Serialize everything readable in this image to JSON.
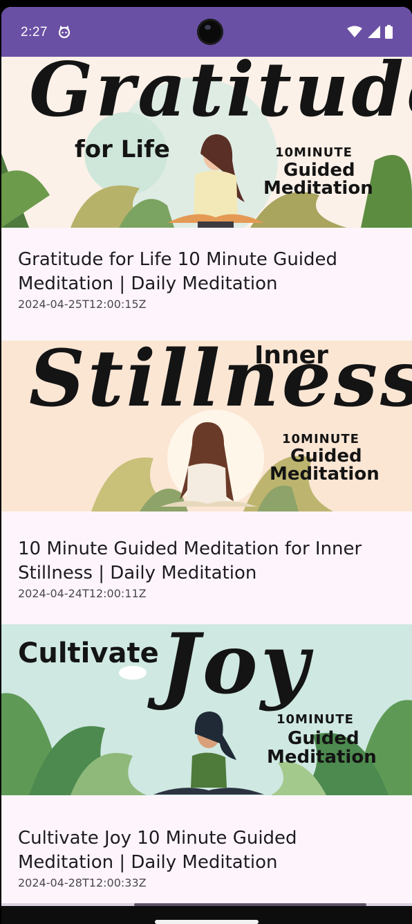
{
  "status_bar": {
    "time": "2:27",
    "app_icon": "cat-face-icon",
    "icons": [
      "wifi-icon",
      "signal-icon",
      "battery-icon"
    ],
    "bg_color": "#6a50a4"
  },
  "videos": [
    {
      "title": "Gratitude for Life 10 Minute Guided Meditation | Daily Meditation",
      "date": "2024-04-25T12:00:15Z",
      "thumb": {
        "script": "Gratitude",
        "headline": "for Life",
        "tag": "10MINUTE",
        "line1": "Guided",
        "line2": "Meditation",
        "bg": "#fbf1e8"
      }
    },
    {
      "title": "10 Minute Guided Meditation for Inner Stillness | Daily Meditation",
      "date": "2024-04-24T12:00:11Z",
      "thumb": {
        "script": "Stillness",
        "headline": "Inner",
        "tag": "10MINUTE",
        "line1": "Guided",
        "line2": "Meditation",
        "bg": "#fbe6d4"
      }
    },
    {
      "title": "Cultivate Joy 10 Minute Guided Meditation | Daily Meditation",
      "date": "2024-04-28T12:00:33Z",
      "thumb": {
        "script": "Joy",
        "headline": "Cultivate",
        "tag": "10MINUTE",
        "line1": "Guided",
        "line2": "Meditation",
        "bg": "#cfe8e2"
      }
    }
  ]
}
